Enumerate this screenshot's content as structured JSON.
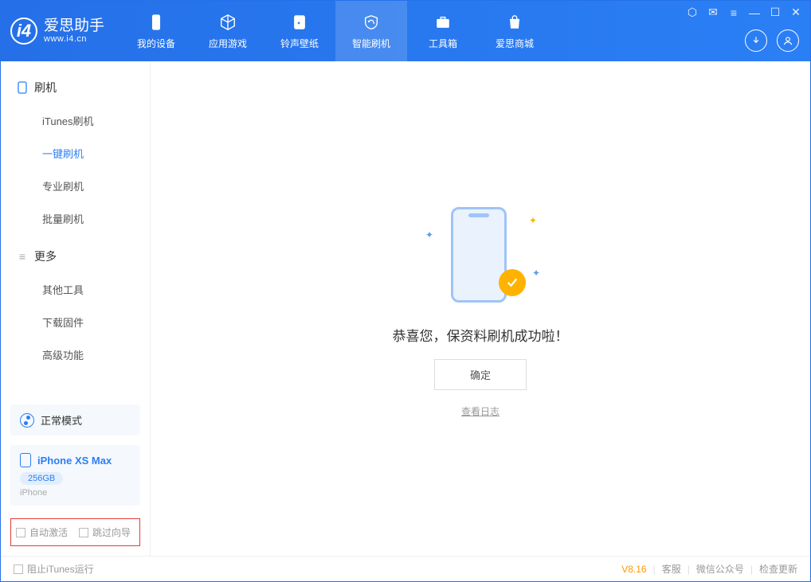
{
  "app": {
    "title": "爱思助手",
    "subtitle": "www.i4.cn"
  },
  "nav": {
    "device": "我的设备",
    "apps": "应用游戏",
    "ring": "铃声壁纸",
    "flash": "智能刷机",
    "tools": "工具箱",
    "store": "爱思商城"
  },
  "sidebar": {
    "sec1": {
      "title": "刷机",
      "items": [
        "iTunes刷机",
        "一键刷机",
        "专业刷机",
        "批量刷机"
      ]
    },
    "sec2": {
      "title": "更多",
      "items": [
        "其他工具",
        "下载固件",
        "高级功能"
      ]
    }
  },
  "mode": {
    "label": "正常模式"
  },
  "device": {
    "name": "iPhone XS Max",
    "storage": "256GB",
    "type": "iPhone"
  },
  "options": {
    "autoActivate": "自动激活",
    "skipGuide": "跳过向导"
  },
  "content": {
    "successMsg": "恭喜您，保资料刷机成功啦！",
    "okBtn": "确定",
    "viewLog": "查看日志"
  },
  "footer": {
    "blockItunes": "阻止iTunes运行",
    "version": "V8.16",
    "support": "客服",
    "wechat": "微信公众号",
    "update": "检查更新"
  }
}
